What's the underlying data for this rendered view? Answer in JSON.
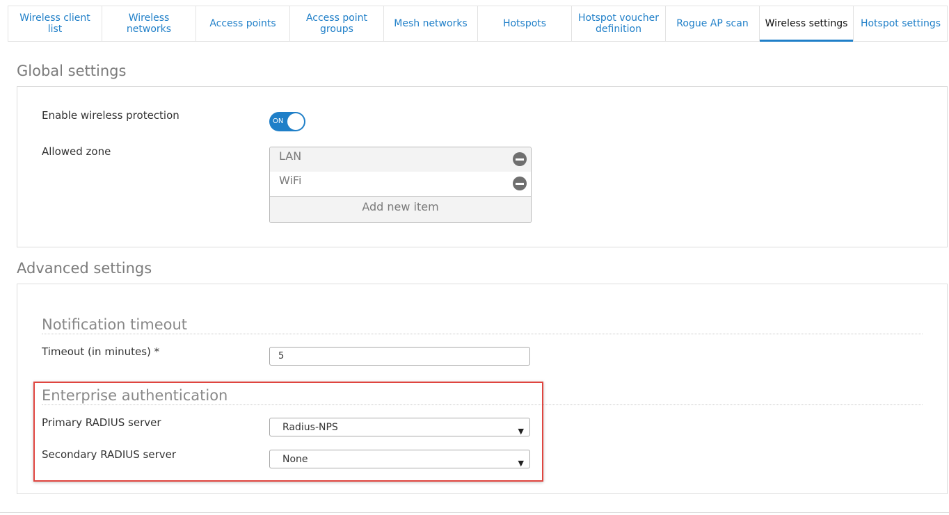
{
  "tabs": [
    {
      "label": "Wireless client list"
    },
    {
      "label": "Wireless networks"
    },
    {
      "label": "Access points"
    },
    {
      "label": "Access point groups"
    },
    {
      "label": "Mesh networks"
    },
    {
      "label": "Hotspots"
    },
    {
      "label": "Hotspot voucher definition"
    },
    {
      "label": "Rogue AP scan"
    },
    {
      "label": "Wireless settings"
    },
    {
      "label": "Hotspot settings"
    }
  ],
  "active_tab": "Wireless settings",
  "global": {
    "title": "Global settings",
    "enable_label": "Enable wireless protection",
    "toggle_text": "ON",
    "toggle_state": true,
    "zone_label": "Allowed zone",
    "zones": [
      "LAN",
      "WiFi"
    ],
    "add_new": "Add new item"
  },
  "advanced": {
    "title": "Advanced settings",
    "notification_heading": "Notification timeout",
    "timeout_label": "Timeout (in minutes) *",
    "timeout_value": "5",
    "enterprise_heading": "Enterprise authentication",
    "primary_label": "Primary RADIUS server",
    "primary_value": "Radius-NPS",
    "secondary_label": "Secondary RADIUS server",
    "secondary_value": "None"
  },
  "colors": {
    "accent": "#1f7fc8",
    "highlight": "#e0453f"
  }
}
